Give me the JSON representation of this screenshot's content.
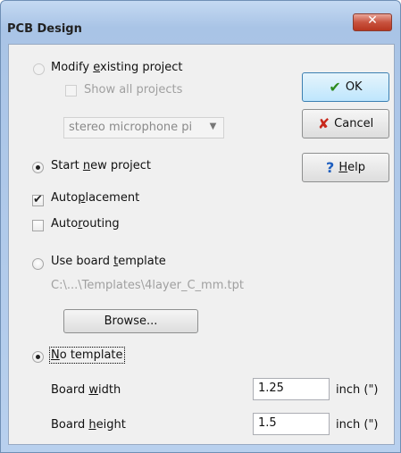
{
  "window": {
    "title": "PCB Design",
    "close_glyph": "✕"
  },
  "options": {
    "modify_existing": {
      "pre": "Modify ",
      "u": "e",
      "post": "xisting project"
    },
    "show_all": "Show all projects",
    "project_select": "stereo microphone pi",
    "start_new": {
      "pre": "Start ",
      "u": "n",
      "post": "ew project"
    },
    "autoplacement": {
      "pre": "Auto",
      "u": "p",
      "post": "lacement"
    },
    "autorouting": {
      "pre": "Auto",
      "u": "r",
      "post": "outing"
    },
    "use_template": {
      "pre": "Use board ",
      "u": "t",
      "post": "emplate"
    },
    "template_path": "C:\\...\\Templates\\4layer_C_mm.tpt",
    "browse": "Browse...",
    "no_template": {
      "pre": "",
      "u": "N",
      "post": "o template"
    }
  },
  "board": {
    "width_label": {
      "pre": "Board ",
      "u": "w",
      "post": "idth"
    },
    "width_value": "1.25",
    "width_unit": "inch (\")",
    "height_label": {
      "pre": "Board ",
      "u": "h",
      "post": "eight"
    },
    "height_value": "1.5",
    "height_unit": "inch (\")"
  },
  "buttons": {
    "ok": "OK",
    "cancel": "Cancel",
    "help": {
      "pre": "",
      "u": "H",
      "post": "elp"
    }
  },
  "icons": {
    "ok": "check-icon",
    "cancel": "x-icon",
    "help": "question-icon"
  },
  "colors": {
    "ok_check": "#2e8b1e",
    "cancel_x": "#c8281b",
    "help_q": "#1f5fbf"
  }
}
